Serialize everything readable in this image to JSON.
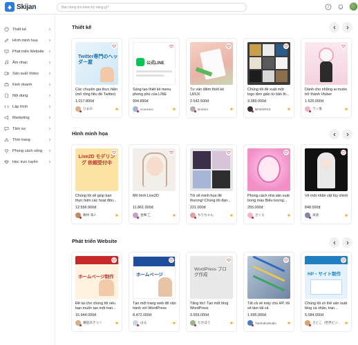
{
  "app": {
    "name": "Skijan"
  },
  "search": {
    "placeholder": "Bạn đang tìm kiếm kỹ năng gì?"
  },
  "sidebar": {
    "items": [
      {
        "label": "Thiết kế",
        "icon": "palette-icon"
      },
      {
        "label": "Hình minh họa",
        "icon": "pen-icon"
      },
      {
        "label": "Phát triển Website",
        "icon": "monitor-icon"
      },
      {
        "label": "Âm nhạc",
        "icon": "music-icon"
      },
      {
        "label": "Sản xuất Video",
        "icon": "video-icon"
      },
      {
        "label": "Kinh doanh",
        "icon": "briefcase-icon"
      },
      {
        "label": "Nội dung",
        "icon": "document-icon"
      },
      {
        "label": "Lập trình",
        "icon": "code-icon"
      },
      {
        "label": "Marketing",
        "icon": "megaphone-icon"
      },
      {
        "label": "Tâm sự",
        "icon": "chat-icon"
      },
      {
        "label": "Thời trang",
        "icon": "hanger-icon"
      },
      {
        "label": "Phong cách sống",
        "icon": "heart-hand-icon"
      },
      {
        "label": "Học trực tuyến",
        "icon": "graduation-icon"
      }
    ]
  },
  "sections": [
    {
      "title": "Thiết kế",
      "cards": [
        {
          "title": "Các chuyên gia thực hiện (mô rộng tiêu đề Twitter)",
          "price": "1.017.800đ",
          "seller": "ひまの",
          "thumb_text": "Twitter専門のヘッダー屋"
        },
        {
          "title": "Sáng tạo thiết kế menu phong phú của LINE",
          "price": "994.890đ",
          "seller": "econnect",
          "thumb_text": "公式LINE"
        },
        {
          "title": "Tư vấn điểm thiết kế UI/UX",
          "price": "2.542.500đ",
          "seller": "kirohiro",
          "thumb_text": ""
        },
        {
          "title": "Chúng tôi đề xuất một logo đơn giản từ bản th...",
          "price": "3.389.000đ",
          "seller": "kEWORKS",
          "thumb_text": ""
        },
        {
          "title": "Dành cho những ai muốn trở thành Vtuber",
          "price": "1.625.000đ",
          "seller": "ラッ兎",
          "thumb_text": ""
        }
      ]
    },
    {
      "title": "Hình minh họa",
      "cards": [
        {
          "title": "Chúng tôi sẽ giúp bạn thực hiện các hoạt độn...",
          "price": "12.556.900đ",
          "seller": "舞林 海人",
          "thumb_text": "Live2D モデリング 依頼受付中"
        },
        {
          "title": "Mô hình Live2D",
          "price": "11.861.000đ",
          "seller": "金輝 匚",
          "thumb_text": ""
        },
        {
          "title": "Tôi sẽ minh họa để thương! Chúng tôi đan...",
          "price": "221.000đ",
          "seller": "ちりちゃん",
          "thumb_text": ""
        },
        {
          "title": "Phong cách nhà sản xuất trong màu Biểu tượng...",
          "price": "255.000đ",
          "seller": "さくら",
          "thumb_text": ""
        },
        {
          "title": "Vẽ một nhân vật tùy chỉnh",
          "price": "848.000đ",
          "seller": "海渡",
          "thumb_text": ""
        }
      ]
    },
    {
      "title": "Phát triển Website",
      "cards": [
        {
          "title": "Để lại cho chúng tôi nếu bạn muốn tạo một tran...",
          "price": "16.944.000đ",
          "seller": "鎌田あきつゞ",
          "thumb_text": "ホームページ制作"
        },
        {
          "title": "Tạo một trang web để vận hành với WordPress",
          "price": "8.472.000đ",
          "seller": "はる",
          "thumb_text": "ホームページ"
        },
        {
          "title": "Tăng tốc! Tạo một blog WordPress",
          "price": "3.559.000đ",
          "seller": "たかぼう",
          "thumb_text": "WordPress ブログ作成"
        },
        {
          "title": "Tất cả về máy chủ HP, tôi sẽ làm tất cả",
          "price": "1.695.000đ",
          "seller": "YashubuStudio",
          "thumb_text": ""
        },
        {
          "title": "Chúng tôi có thể sản xuất blog cá nhân, tran...",
          "price": "5.084.000đ",
          "seller": "さとこ（世界ビジ...",
          "thumb_text": "HP・サイト制作"
        }
      ]
    }
  ],
  "colors": {
    "accent": "#2c7be5",
    "brand_red": "#c62828",
    "star": "#f5a623"
  }
}
